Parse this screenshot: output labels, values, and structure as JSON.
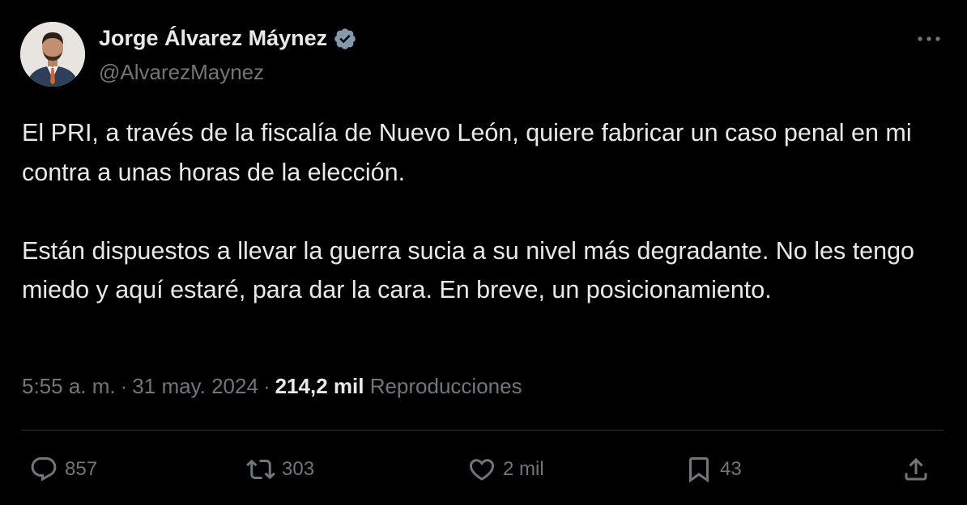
{
  "author": {
    "display_name": "Jorge Álvarez Máynez",
    "handle": "@AlvarezMaynez",
    "verified": true,
    "verified_color": "#829aab"
  },
  "tweet": {
    "paragraphs": [
      "El PRI, a través de la fiscalía de Nuevo León, quiere fabricar un caso penal en mi contra a unas horas de la elección.",
      "Están dispuestos a llevar la guerra sucia a su nivel más degradante. No les tengo miedo y aquí estaré, para dar la cara. En breve, un posicionamiento."
    ],
    "time": "5:55 a. m.",
    "separator": "·",
    "date": "31 may. 2024",
    "views_count": "214,2 mil",
    "views_label": "Reproducciones"
  },
  "actions": {
    "replies": "857",
    "reposts": "303",
    "likes": "2 mil",
    "bookmarks": "43"
  },
  "icons": [
    "more-icon",
    "verified-badge-icon",
    "reply-icon",
    "repost-icon",
    "like-icon",
    "bookmark-icon",
    "share-icon"
  ],
  "colors": {
    "background": "#000000",
    "text_primary": "#e7e9ea",
    "text_secondary": "#71767b",
    "divider": "#2f3336"
  }
}
